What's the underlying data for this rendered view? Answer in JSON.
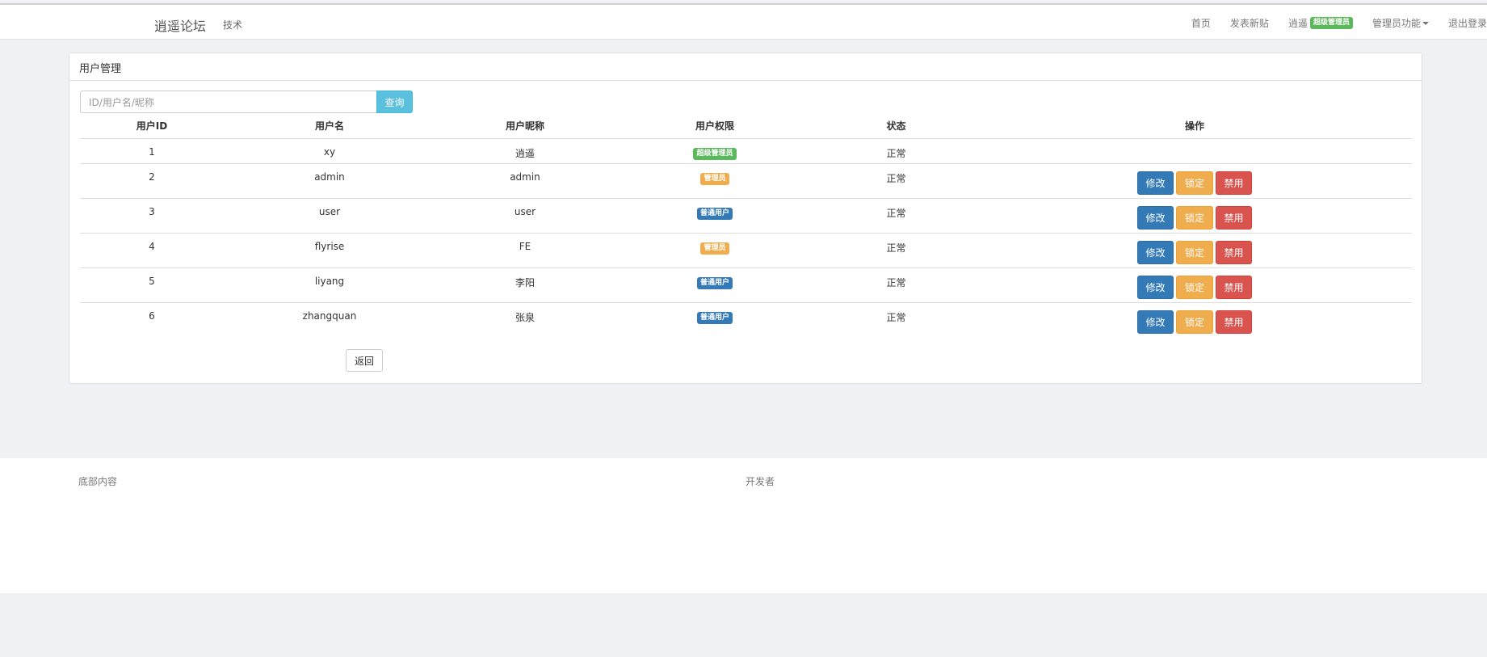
{
  "navbar": {
    "brand": "逍遥论坛",
    "left_link": "技术",
    "home": "首页",
    "new_post": "发表新贴",
    "username": "逍遥",
    "user_role_badge": "超级管理员",
    "admin_menu": "管理员功能",
    "logout": "退出登录"
  },
  "panel": {
    "title": "用户管理",
    "search_placeholder": "ID/用户名/昵称",
    "search_button": "查询",
    "back_button": "返回"
  },
  "table": {
    "headers": [
      "用户ID",
      "用户名",
      "用户昵称",
      "用户权限",
      "状态",
      "操作"
    ],
    "rows": [
      {
        "id": "1",
        "username": "xy",
        "nickname": "逍遥",
        "role": "超级管理员",
        "status": "正常"
      },
      {
        "id": "2",
        "username": "admin",
        "nickname": "admin",
        "role": "管理员",
        "status": "正常"
      },
      {
        "id": "3",
        "username": "user",
        "nickname": "user",
        "role": "普通用户",
        "status": "正常"
      },
      {
        "id": "4",
        "username": "flyrise",
        "nickname": "FE",
        "role": "管理员",
        "status": "正常"
      },
      {
        "id": "5",
        "username": "liyang",
        "nickname": "李阳",
        "role": "普通用户",
        "status": "正常"
      },
      {
        "id": "6",
        "username": "zhangquan",
        "nickname": "张泉",
        "role": "普通用户",
        "status": "正常"
      }
    ],
    "actions": {
      "edit": "修改",
      "lock": "锁定",
      "ban": "禁用"
    }
  },
  "footer": {
    "left": "底部内容",
    "middle": "开发者"
  },
  "colors": {
    "super_admin": "#5cb85c",
    "admin": "#f0ad4e",
    "normal_user": "#337ab7",
    "edit": "#337ab7",
    "lock": "#f0ad4e",
    "ban": "#d9534f",
    "search": "#5bc0de"
  }
}
